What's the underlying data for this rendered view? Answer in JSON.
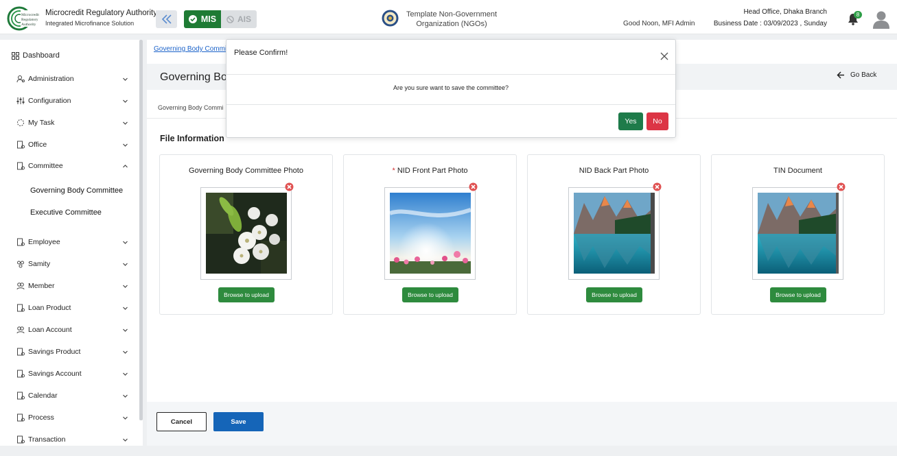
{
  "header": {
    "brand_title": "Microcredit Regulatory Authority",
    "brand_subtitle": "Integrated Microfinance Solution",
    "logo_text": "Microcredit Regulatory Authority",
    "mis_label": "MIS",
    "ais_label": "AIS",
    "org_name": "Template Non-Government Organization (NGOs)",
    "greeting": "Good Noon, MFI Admin",
    "branch": "Head Office, Dhaka Branch",
    "business_date": "Business Date : 03/09/2023 , Sunday",
    "notification_count": "8",
    "colors": {
      "mis": "#1e7b34",
      "badge": "#2e9e47"
    }
  },
  "sidebar": {
    "dashboard": "Dashboard",
    "items": [
      {
        "label": "Administration",
        "icon": "users-cog-icon"
      },
      {
        "label": "Configuration",
        "icon": "sliders-icon"
      },
      {
        "label": "My Task",
        "icon": "task-circle-icon"
      },
      {
        "label": "Office",
        "icon": "building-icon"
      },
      {
        "label": "Committee",
        "icon": "committee-icon"
      },
      {
        "label": "Employee",
        "icon": "employee-icon"
      },
      {
        "label": "Samity",
        "icon": "group-icon"
      },
      {
        "label": "Member",
        "icon": "members-icon"
      },
      {
        "label": "Loan Product",
        "icon": "document-icon"
      },
      {
        "label": "Loan Account",
        "icon": "account-icon"
      },
      {
        "label": "Savings Product",
        "icon": "document-icon"
      },
      {
        "label": "Savings Account",
        "icon": "document-icon"
      },
      {
        "label": "Calendar",
        "icon": "calendar-icon"
      },
      {
        "label": "Process",
        "icon": "process-icon"
      },
      {
        "label": "Transaction",
        "icon": "transaction-icon"
      }
    ],
    "committee_sub": [
      "Governing Body Committee",
      "Executive Committee"
    ]
  },
  "main": {
    "breadcrumb": "Governing Body Commi",
    "title": "Governing Bo",
    "go_back": "Go Back",
    "sub_breadcrumb": "Governing Body Commi",
    "section_title": "File Information",
    "cards": [
      {
        "title": "Governing Body Committee Photo",
        "required": false,
        "image": "white-blossom-photo"
      },
      {
        "title": "NID Front Part Photo",
        "required": true,
        "image": "sky-flowers-photo"
      },
      {
        "title": "NID Back Part Photo",
        "required": false,
        "image": "mountain-lake-photo"
      },
      {
        "title": "TIN Document",
        "required": false,
        "image": "mountain-lake-photo"
      }
    ],
    "browse_label": "Browse to upload",
    "cancel_label": "Cancel",
    "save_label": "Save"
  },
  "modal": {
    "title": "Please Confirm!",
    "message": "Are you sure want to save the committee?",
    "yes_label": "Yes",
    "no_label": "No"
  }
}
